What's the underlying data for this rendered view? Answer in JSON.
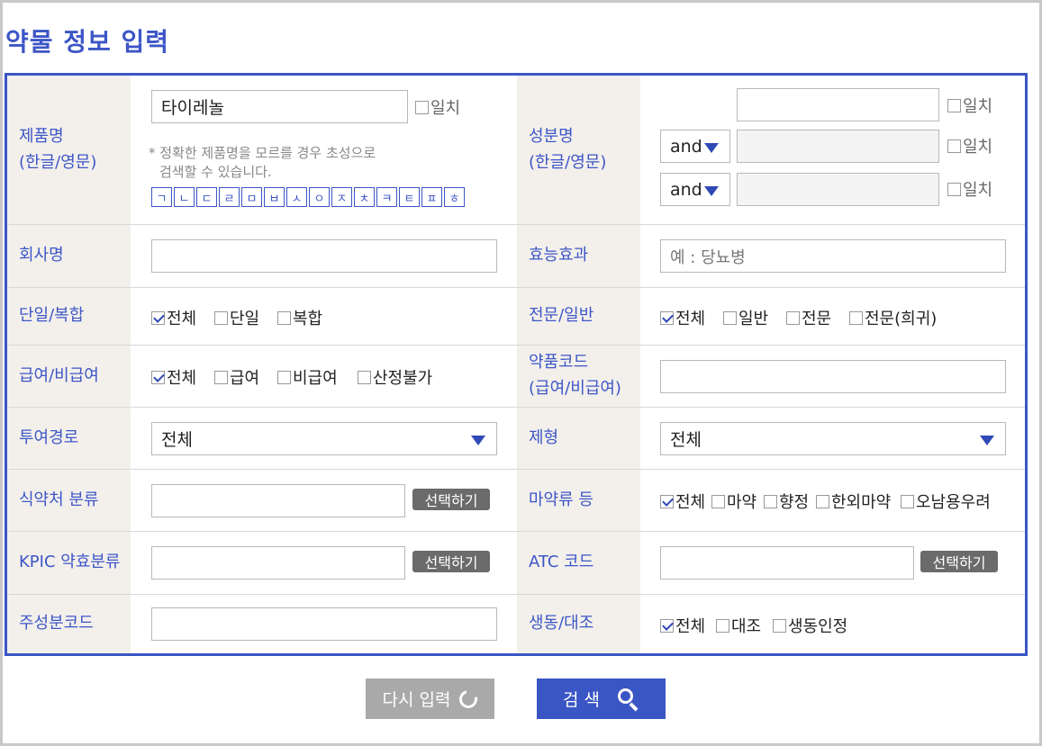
{
  "page_title": "약물 정보 입력",
  "product": {
    "label_lines": [
      "제품명",
      "(한글/영문)"
    ],
    "value": "타이레놀",
    "exact_label": "일치",
    "hint_lines": [
      "* 정확한 제품명을 모르를 경우 초성으로",
      "검색할 수 있습니다."
    ],
    "jamo": [
      "ㄱ",
      "ㄴ",
      "ㄷ",
      "ㄹ",
      "ㅁ",
      "ㅂ",
      "ㅅ",
      "ㅇ",
      "ㅈ",
      "ㅊ",
      "ㅋ",
      "ㅌ",
      "ㅍ",
      "ㅎ"
    ]
  },
  "ingredient": {
    "label_lines": [
      "성분명",
      "(한글/영문)"
    ],
    "exact_label": "일치",
    "operators": [
      "and",
      "and"
    ]
  },
  "company": {
    "label": "회사명",
    "value": ""
  },
  "efficacy": {
    "label": "효능효과",
    "placeholder": "예 : 당뇨병"
  },
  "single_combo": {
    "label": "단일/복합",
    "options": [
      {
        "label": "전체",
        "checked": true
      },
      {
        "label": "단일",
        "checked": false
      },
      {
        "label": "복합",
        "checked": false
      }
    ]
  },
  "rx_otc": {
    "label": "전문/일반",
    "options": [
      {
        "label": "전체",
        "checked": true
      },
      {
        "label": "일반",
        "checked": false
      },
      {
        "label": "전문",
        "checked": false
      },
      {
        "label": "전문(희귀)",
        "checked": false
      }
    ]
  },
  "coverage": {
    "label": "급여/비급여",
    "options": [
      {
        "label": "전체",
        "checked": true
      },
      {
        "label": "급여",
        "checked": false
      },
      {
        "label": "비급여",
        "checked": false
      },
      {
        "label": "산정불가",
        "checked": false
      }
    ]
  },
  "drug_code": {
    "label_lines": [
      "약품코드",
      "(급여/비급여)"
    ],
    "value": ""
  },
  "route": {
    "label": "투여경로",
    "selected": "전체"
  },
  "form": {
    "label": "제형",
    "selected": "전체"
  },
  "mfds_class": {
    "label": "식약처 분류",
    "button": "선택하기"
  },
  "narcotic": {
    "label": "마약류 등",
    "options": [
      {
        "label": "전체",
        "checked": true
      },
      {
        "label": "마약",
        "checked": false
      },
      {
        "label": "향정",
        "checked": false
      },
      {
        "label": "한외마약",
        "checked": false
      },
      {
        "label": "오남용우려",
        "checked": false
      }
    ]
  },
  "kpic": {
    "label": "KPIC 약효분류",
    "button": "선택하기"
  },
  "atc": {
    "label": "ATC 코드",
    "button": "선택하기"
  },
  "main_ingredient_code": {
    "label": "주성분코드"
  },
  "bioequivalence": {
    "label": "생동/대조",
    "options": [
      {
        "label": "전체",
        "checked": true
      },
      {
        "label": "대조",
        "checked": false
      },
      {
        "label": "생동인정",
        "checked": false
      }
    ]
  },
  "actions": {
    "reset": "다시 입력",
    "search": "검 색"
  },
  "colors": {
    "accent": "#3a55c4",
    "label_bg": "#f3f0ec",
    "button_gray": "#6b6b6b"
  }
}
